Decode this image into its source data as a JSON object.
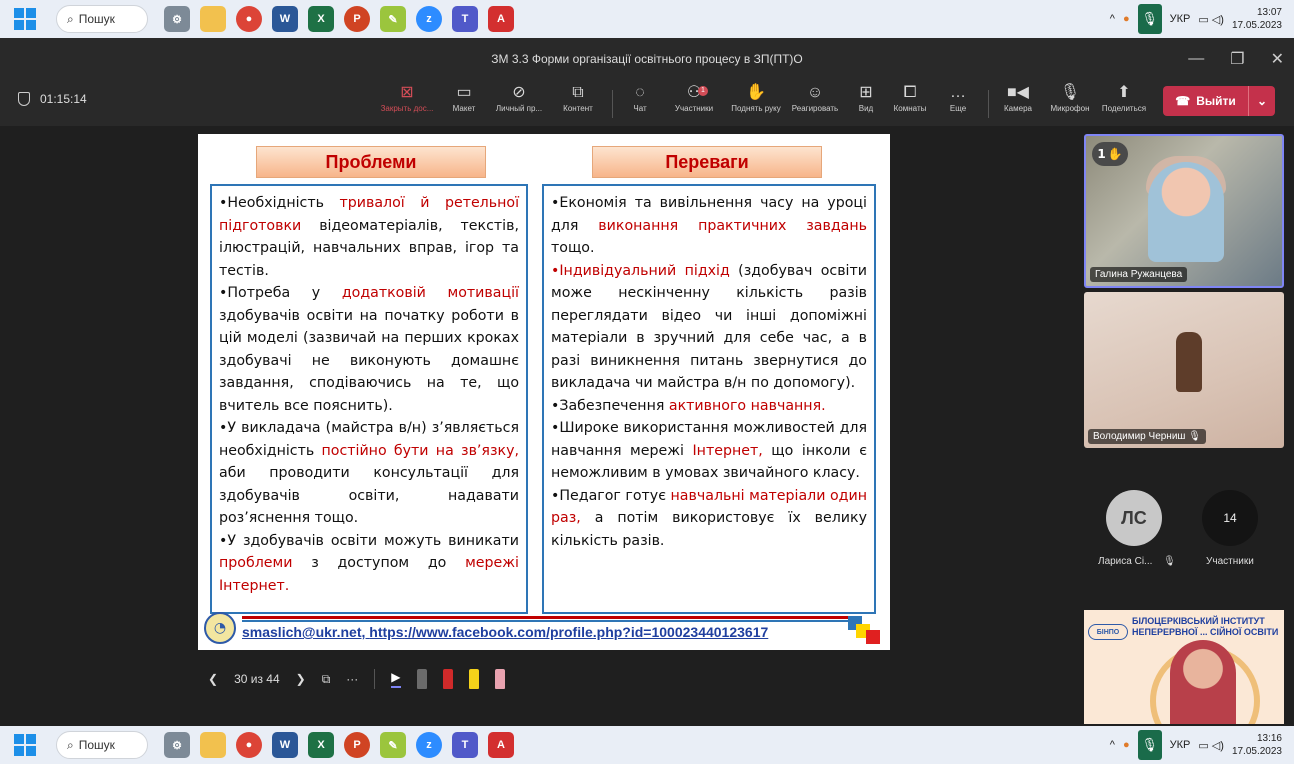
{
  "taskbar": {
    "search_label": "Пошук",
    "lang": "УКР",
    "top_time": "13:07",
    "top_date": "17.05.2023",
    "bottom_time": "13:16",
    "bottom_date": "17.05.2023",
    "apps": [
      "gear-icon",
      "folder-icon",
      "chrome-icon",
      "word-icon",
      "excel-icon",
      "powerpoint-icon",
      "paint-icon",
      "zoom-icon",
      "teams-icon",
      "pdf-icon"
    ]
  },
  "window": {
    "title": "ЗМ 3.3 Форми організації освітнього процесу в ЗП(ПТ)О"
  },
  "meeting": {
    "timer": "01:15:14",
    "tools": [
      {
        "id": "stop-share",
        "label": "Закрыть дос..."
      },
      {
        "id": "layout",
        "label": "Макет"
      },
      {
        "id": "private-view",
        "label": "Личный пр..."
      },
      {
        "id": "content",
        "label": "Контент"
      },
      {
        "id": "chat",
        "label": "Чат"
      },
      {
        "id": "participants",
        "label": "Участники"
      },
      {
        "id": "raise-hand",
        "label": "Поднять руку"
      },
      {
        "id": "react",
        "label": "Реагировать"
      },
      {
        "id": "view",
        "label": "Вид"
      },
      {
        "id": "rooms",
        "label": "Комнаты"
      },
      {
        "id": "more",
        "label": "Еще"
      },
      {
        "id": "camera",
        "label": "Камера"
      },
      {
        "id": "mic",
        "label": "Микрофон"
      },
      {
        "id": "share",
        "label": "Поделиться"
      }
    ],
    "participants_badge": "1",
    "leave_label": "Выйти"
  },
  "slide": {
    "left_header": "Проблеми",
    "right_header": "Переваги",
    "left_parts": [
      "•Необхідність ",
      "тривалої й ретельної підготовки",
      " відеоматеріалів, текстів, ілюстрацій, навчальних вправ, ігор та тестів.",
      "•Потреба у ",
      "додатковій мотивації",
      " здобувачів освіти на початку роботи в цій моделі (зазвичай на перших кроках здобувачі не виконують домашнє завдання, сподіваючись на те, що вчитель все пояснить).",
      "•У викладача (майстра в/н) з’являється необхідність ",
      "постійно бути на зв’язку,",
      " аби проводити консультації для здобувачів освіти, надавати роз’яснення тощо.",
      "•У здобувачів освіти можуть виникати ",
      "проблеми",
      " з доступом до ",
      "мережі Інтернет."
    ],
    "right_parts": [
      "•Економія та вивільнення часу на уроці для ",
      "виконання практичних завдань",
      " тощо.",
      "•Індивідуальний підхід",
      " (здобувач освіти може нескінченну кількість разів переглядати відео чи інші допоміжні матеріали в зручний для себе час, а в разі виникнення питань звернутися до викладача чи майстра в/н по допомогу).",
      "•Забезпечення ",
      "активного навчання.",
      "•Широке використання можливостей для навчання мережі ",
      "Інтернет,",
      " що інколи є неможливим в умовах звичайного класу.",
      "•Педагог готує ",
      "навчальні матеріали один раз,",
      " а потім використовує їх велику кількість разів."
    ],
    "footer_email": "smaslich@ukr.net",
    "footer_url": "https://www.facebook.com/profile.php?id=100023440123617",
    "colors": {
      "highlight": "#c00000",
      "border": "#2e75b6"
    }
  },
  "presenter": {
    "page_indicator": "30 из 44"
  },
  "participants": {
    "tile1_name": "Галина Ружанцева",
    "tile1_hand_count": "1",
    "tile2_name": "Володимир Черниш",
    "avatar_initials": "ЛС",
    "avatar_name": "Лариса Сі...",
    "count": "14",
    "count_label": "Участники"
  },
  "self_view": {
    "logo": "БІНПО",
    "title_line1": "БІЛОЦЕРКІВСЬКИЙ ІНСТИТУТ",
    "title_line2": "НЕПЕРЕРВНОЇ ... СІЙНОЇ ОСВІТИ"
  }
}
